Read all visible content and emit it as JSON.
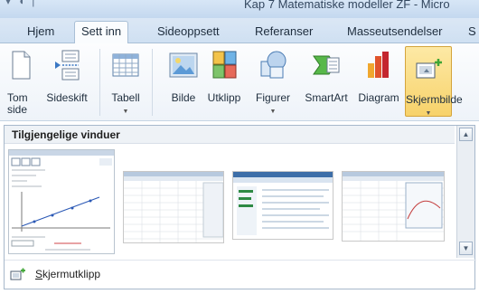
{
  "window": {
    "title": "Kap 7 Matematiske modeller ZF - Micro"
  },
  "tabs": [
    {
      "label": "Hjem"
    },
    {
      "label": "Sett inn",
      "active": true
    },
    {
      "label": "Sideoppsett"
    },
    {
      "label": "Referanser"
    },
    {
      "label": "Masseutsendelser"
    },
    {
      "label": "S"
    }
  ],
  "ribbon": {
    "buttons": [
      {
        "label1": "Tom",
        "label2": "side",
        "icon": "blank-page-icon"
      },
      {
        "label1": "Sideskift",
        "icon": "page-break-icon"
      },
      {
        "label1": "Tabell",
        "icon": "table-icon",
        "dropdown": true
      },
      {
        "label1": "Bilde",
        "icon": "picture-icon"
      },
      {
        "label1": "Utklipp",
        "icon": "clip-art-icon"
      },
      {
        "label1": "Figurer",
        "icon": "shapes-icon",
        "dropdown": true
      },
      {
        "label1": "SmartArt",
        "icon": "smartart-icon"
      },
      {
        "label1": "Diagram",
        "icon": "chart-icon"
      },
      {
        "label1": "Skjermbilde",
        "icon": "screenshot-icon",
        "dropdown": true,
        "selected": true
      }
    ]
  },
  "gallery": {
    "header": "Tilgjengelige vinduer",
    "footer_accel": "S",
    "footer_rest": "kjermutklipp",
    "thumbnails": [
      {
        "name": "geogebra-window"
      },
      {
        "name": "spreadsheet-window-1"
      },
      {
        "name": "browser-window"
      },
      {
        "name": "spreadsheet-window-2"
      }
    ]
  },
  "colors": {
    "accent": "#f7d26a",
    "tab_bg": "#cfe0f2",
    "green_arrow": "#3fa535"
  }
}
